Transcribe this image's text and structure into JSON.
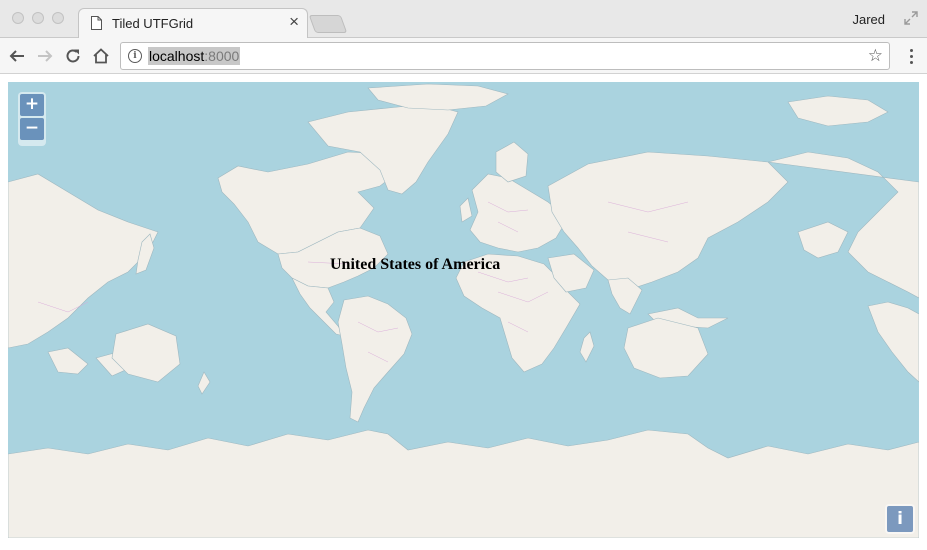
{
  "browser": {
    "tab_title": "Tiled UTFGrid",
    "tab_close": "×",
    "profile_name": "Jared",
    "url_host": "localhost",
    "url_port": ":8000",
    "info_glyph": "i",
    "star_glyph": "☆"
  },
  "map": {
    "zoom_in_label": "+",
    "zoom_out_label": "−",
    "hover_label": "United States of America",
    "attribution_label": "i",
    "colors": {
      "water": "#aad3df",
      "land": "#f2efe9",
      "borders": "#d9a9d8"
    }
  }
}
